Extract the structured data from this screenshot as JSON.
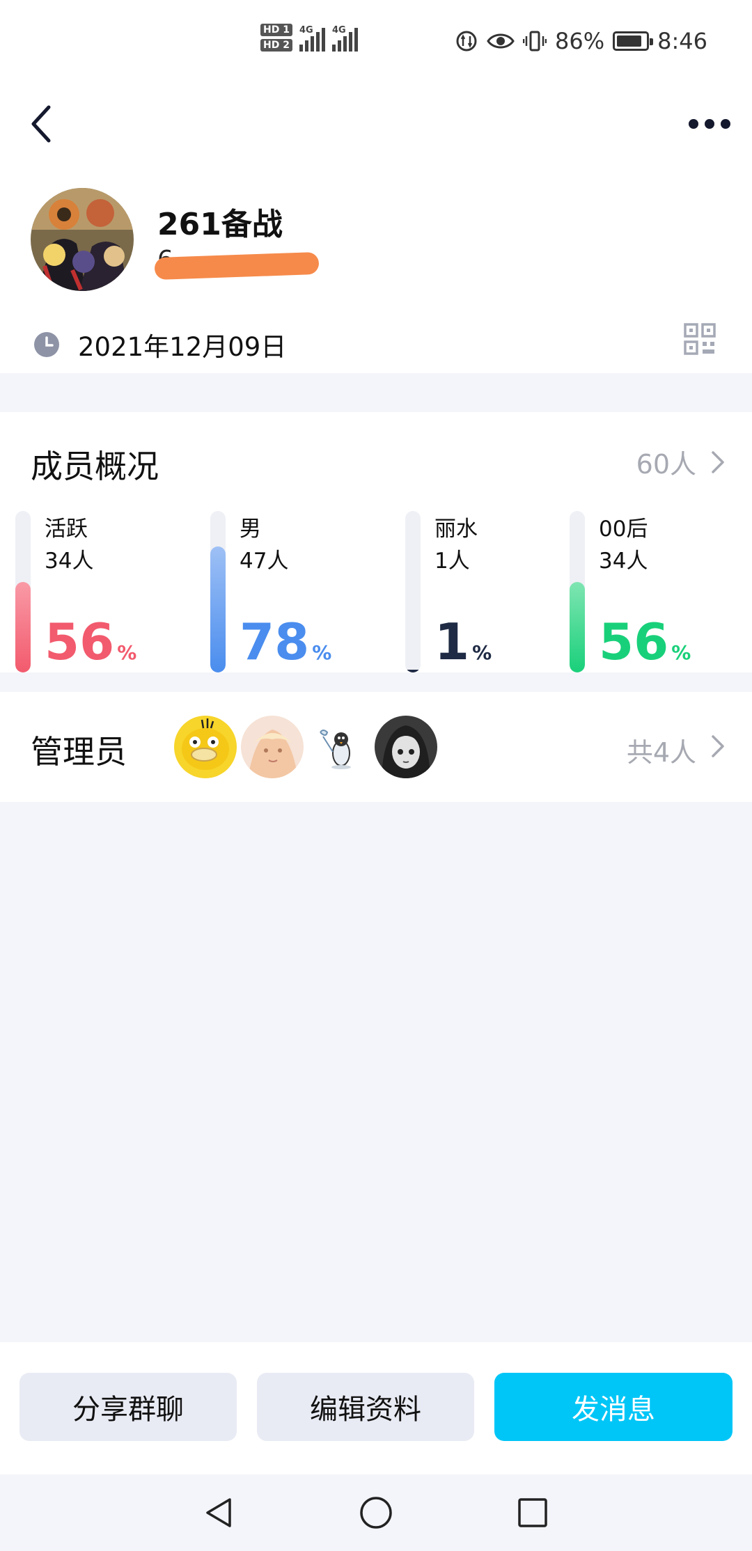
{
  "status_bar": {
    "hd1": "HD 1",
    "hd2": "HD 2",
    "net1": "4G",
    "net2": "4G",
    "battery_pct": "86%",
    "battery_level": 0.86,
    "time": "8:46"
  },
  "group": {
    "name": "261备战",
    "id_partial": "6",
    "created_date": "2021年12月09日"
  },
  "members": {
    "title": "成员概况",
    "total": "60人",
    "stats": [
      {
        "label": "活跃",
        "count": "34人",
        "percent": "56",
        "percent_sign": "%",
        "level": 0.56,
        "color": "#f25a6d",
        "bar_color_top": "#f99aa6"
      },
      {
        "label": "男",
        "count": "47人",
        "percent": "78",
        "percent_sign": "%",
        "level": 0.78,
        "color": "#4a8dee",
        "bar_color_top": "#9ec0f5"
      },
      {
        "label": "丽水",
        "count": "1人",
        "percent": "1",
        "percent_sign": "%",
        "level": 0.01,
        "color": "#1f2a44",
        "bar_color_top": "#1f2a44"
      },
      {
        "label": "00后",
        "count": "34人",
        "percent": "56",
        "percent_sign": "%",
        "level": 0.56,
        "color": "#19d07a",
        "bar_color_top": "#7fe5b2"
      }
    ]
  },
  "admins": {
    "title": "管理员",
    "total": "共4人",
    "avatars": [
      "psyduck-avatar",
      "anime-girl-avatar",
      "penguin-avatar",
      "grayscale-girl-avatar"
    ]
  },
  "actions": {
    "share": "分享群聊",
    "edit": "编辑资料",
    "message": "发消息"
  },
  "colors": {
    "primary": "#00c6f7",
    "muted": "#a7a9b2",
    "background": "#f4f5fa"
  }
}
